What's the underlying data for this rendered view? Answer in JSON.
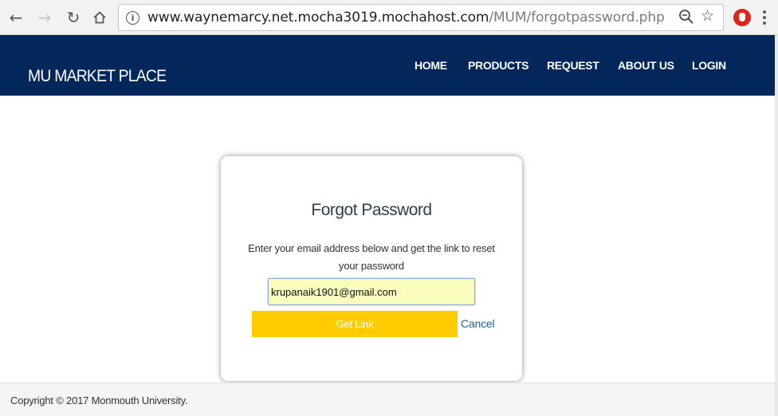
{
  "browser": {
    "url_host": "www.waynemarcy.net.mocha3019.mochahost.com",
    "url_path": "/MUM/forgotpassword.php",
    "icons": {
      "back": "back-arrow-icon",
      "forward": "forward-arrow-icon",
      "reload": "reload-icon",
      "home": "home-icon",
      "site_info": "info-icon",
      "zoom": "zoom-icon",
      "bookmark": "star-icon",
      "extension": "adblock-extension-icon",
      "menu": "menu-dots-icon"
    }
  },
  "header": {
    "brand": "MU MARKET PLACE",
    "nav": [
      "HOME",
      "PRODUCTS",
      "REQUEST",
      "ABOUT US",
      "LOGIN"
    ],
    "background_color": "#03275a"
  },
  "form": {
    "title": "Forgot Password",
    "description": "Enter your email address below and get the link to reset your password",
    "email_value": "krupanaik1901@gmail.com",
    "submit_label": "Get Link",
    "cancel_label": "Cancel",
    "submit_color": "#ffcc00"
  },
  "footer": {
    "copyright": "Copyright © 2017 Monmouth University."
  }
}
